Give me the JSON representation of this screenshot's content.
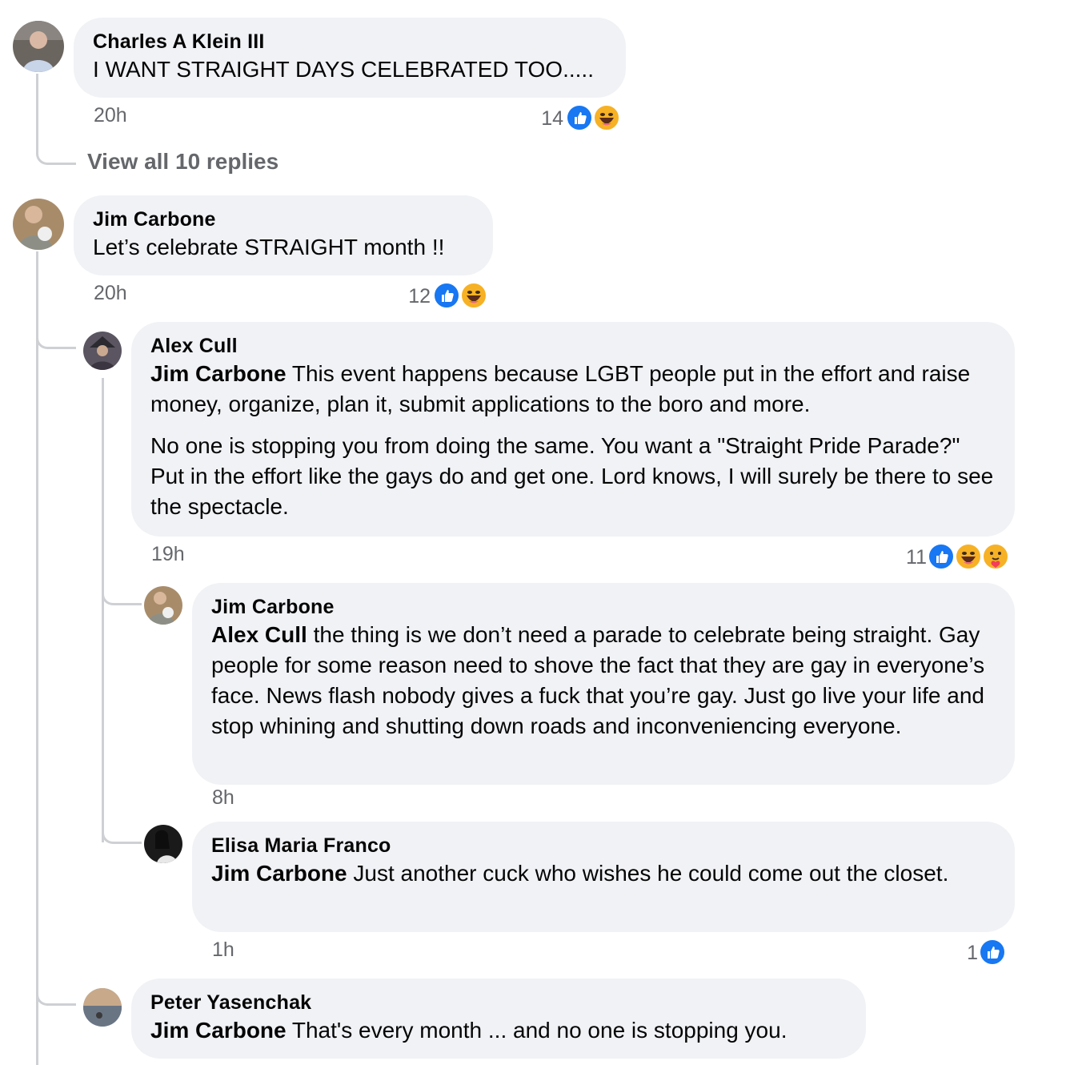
{
  "thread": {
    "comment1": {
      "author": "Charles A Klein III",
      "text": "I WANT STRAIGHT DAYS CELEBRATED TOO.....",
      "time": "20h",
      "reaction_count": "14",
      "reactions": [
        "like-icon",
        "haha-icon"
      ]
    },
    "view_replies_label": "View all 10 replies",
    "comment2": {
      "author": "Jim Carbone",
      "text": "Let’s celebrate STRAIGHT month !!",
      "time": "20h",
      "reaction_count": "12",
      "reactions": [
        "like-icon",
        "haha-icon"
      ]
    },
    "reply1": {
      "author": "Alex Cull",
      "mention": "Jim Carbone",
      "text1": " This event happens because LGBT people put in the effort and raise money, organize, plan it, submit applications to the boro and more.",
      "text2": "No one is stopping you from doing the same. You want a \"Straight Pride Parade?\" Put in the effort like the gays do and get one. Lord knows, I will surely be there to see the spectacle.",
      "time": "19h",
      "reaction_count": "11",
      "reactions": [
        "like-icon",
        "haha-icon",
        "care-icon"
      ]
    },
    "reply2": {
      "author": "Jim Carbone",
      "mention": "Alex Cull",
      "text": " the thing is we don’t need a parade to celebrate being straight. Gay people for some reason need to shove the fact that they are gay in everyone’s face. News flash nobody gives a fuck that you’re gay. Just go live your life and stop whining and shutting down roads and inconveniencing everyone.",
      "time": "8h"
    },
    "reply3": {
      "author": "Elisa Maria Franco",
      "mention": "Jim Carbone",
      "text": " Just another cuck who wishes he could come out the closet.",
      "time": "1h",
      "reaction_count": "1",
      "reactions": [
        "like-icon"
      ]
    },
    "reply4": {
      "author": "Peter Yasenchak",
      "mention": "Jim Carbone",
      "text": " That's every month ... and no one is stopping you."
    }
  },
  "colors": {
    "bubble": "#f0f2f5",
    "meta_text": "#65676b",
    "thread_line": "#ced0d4",
    "like_blue": "#1877f2",
    "haha_yellow": "#f7b125"
  }
}
